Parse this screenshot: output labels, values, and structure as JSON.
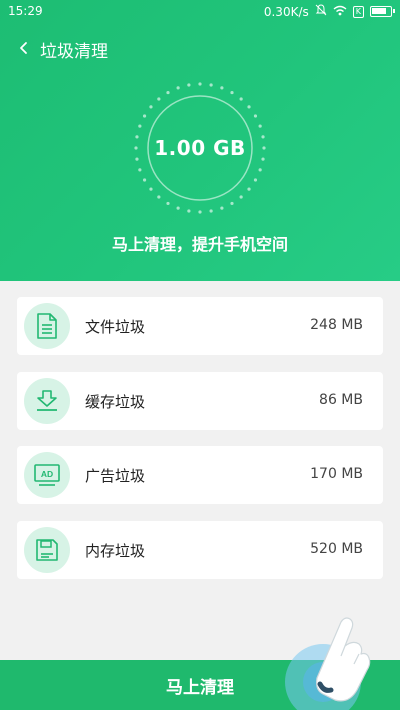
{
  "statusbar": {
    "time": "15:29",
    "speed": "0.30K/s",
    "sim": "K"
  },
  "header": {
    "title": "垃圾清理",
    "total_size": "1.00 GB",
    "subtitle": "马上清理，提升手机空间"
  },
  "items": [
    {
      "label": "文件垃圾",
      "value": "248 MB",
      "icon": "file-icon"
    },
    {
      "label": "缓存垃圾",
      "value": "86 MB",
      "icon": "download-icon"
    },
    {
      "label": "广告垃圾",
      "value": "170 MB",
      "icon": "ad-monitor-icon",
      "icon_text": "AD"
    },
    {
      "label": "内存垃圾",
      "value": "520 MB",
      "icon": "storage-disk-icon"
    }
  ],
  "action": {
    "label": "马上清理"
  },
  "colors": {
    "brand": "#1fb96d",
    "icon_bg": "#d7f3e6",
    "background": "#f1f1f1"
  }
}
